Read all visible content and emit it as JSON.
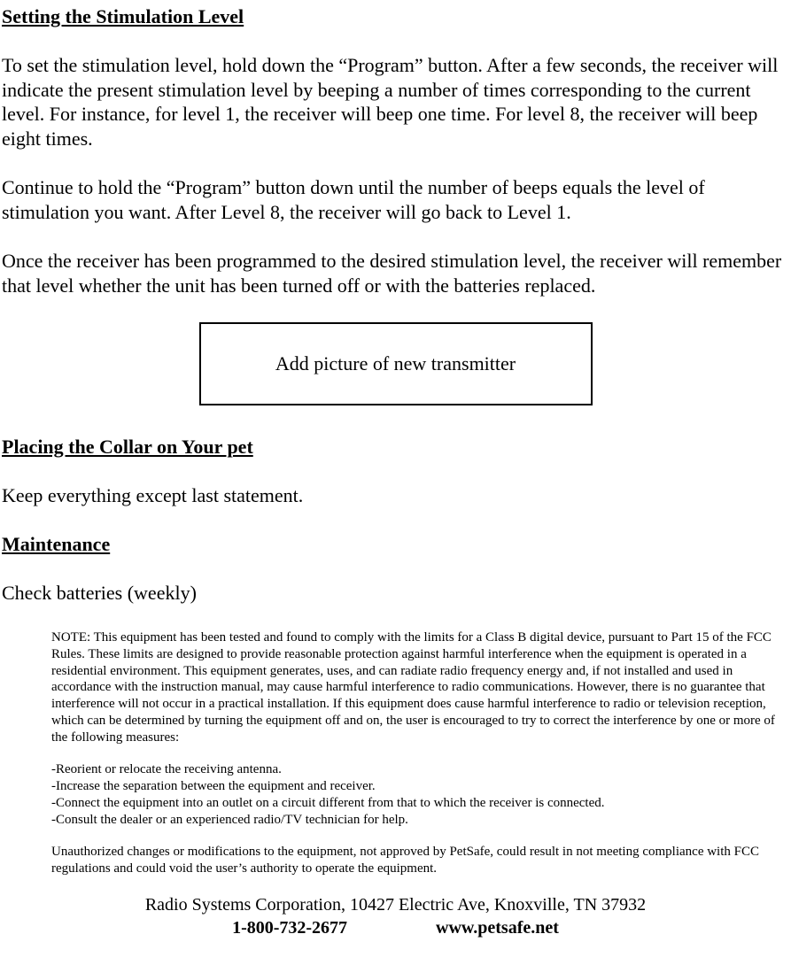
{
  "section1": {
    "heading": "Setting the Stimulation Level",
    "p1": "To set the stimulation level, hold down the “Program” button.  After a few seconds, the receiver will indicate the present stimulation level by beeping a number of times corresponding to the current level.  For instance, for level 1, the receiver will beep one time.  For level 8, the receiver will beep eight times.",
    "p2": "Continue to hold the “Program” button down until the number of beeps equals the level of stimulation you want.  After Level 8, the receiver will go back to Level 1.",
    "p3": "Once the receiver has been programmed to the desired stimulation level, the receiver will remember that level whether the unit has been turned off or with the batteries replaced."
  },
  "image_placeholder": "Add picture of new transmitter",
  "section2": {
    "heading": "Placing the Collar on Your pet",
    "p1": "Keep everything except last statement."
  },
  "section3": {
    "heading": "Maintenance",
    "p1": "Check batteries (weekly)"
  },
  "fcc": {
    "note": "NOTE:  This equipment has been tested and found to comply with the limits for a Class B digital device, pursuant to Part 15 of the FCC Rules.  These limits are designed to provide reasonable protection against harmful interference when the equipment is operated in a residential environment.  This equipment generates, uses, and can radiate radio frequency energy and, if not installed and used in accordance with the instruction manual, may cause harmful interference to radio communications.  However, there is no guarantee that interference will not occur in a practical installation.  If this equipment does cause harmful interference to radio or television reception, which can be determined by turning the equipment off and on, the user is encouraged to try to correct the interference by one or more of the following measures:",
    "m1": "-Reorient or relocate the receiving antenna.",
    "m2": "-Increase the separation between the equipment and receiver.",
    "m3": "-Connect the equipment into an outlet on a circuit different from that to which the receiver is connected.",
    "m4": "-Consult the dealer or an experienced radio/TV technician for help.",
    "warn": "Unauthorized changes or modifications to the equipment, not approved by PetSafe, could result in not meeting compliance with FCC regulations and could void the user’s authority to operate the equipment."
  },
  "footer": {
    "line1": "Radio Systems Corporation, 10427 Electric Ave, Knoxville, TN 37932",
    "phone": "1-800-732-2677",
    "url": "www.petsafe.net"
  }
}
